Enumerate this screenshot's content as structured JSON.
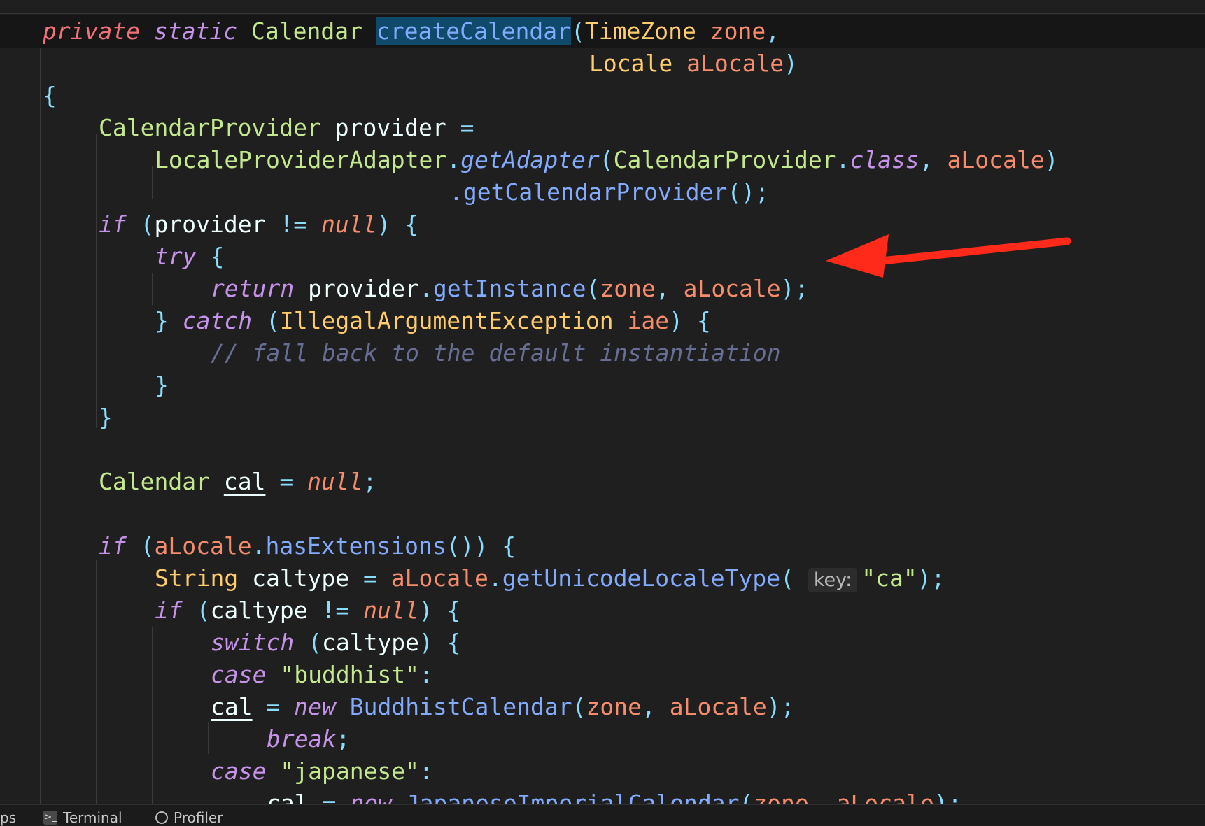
{
  "code": {
    "l1": {
      "mod1": "private",
      "mod2": "static",
      "type": "Calendar",
      "fn": "createCalendar",
      "p1": "(",
      "type2": "TimeZone",
      "param": "zone",
      "comma": ","
    },
    "l2": {
      "type": "Locale",
      "param": "aLocale",
      "close": ")"
    },
    "l3": {
      "brace": "{"
    },
    "l4": {
      "type": "CalendarProvider",
      "var": "provider",
      "op": "="
    },
    "l5": {
      "type": "LocaleProviderAdapter",
      "dot": ".",
      "fn": "getAdapter",
      "p1": "(",
      "type2": "CalendarProvider",
      "dot2": ".",
      "kw": "class",
      "comma": ",",
      "param": "aLocale",
      "close": ")"
    },
    "l6": {
      "fn": ".getCalendarProvider",
      "rest": "();"
    },
    "l7": {
      "kw": "if",
      "p1": "(",
      "var": "provider",
      "op": "!=",
      "nul": "null",
      "close": ")",
      "brace": "{"
    },
    "l8": {
      "kw": "try",
      "brace": "{"
    },
    "l9": {
      "kw": "return",
      "var": "provider",
      "dot": ".",
      "fn": "getInstance",
      "p1": "(",
      "param": "zone",
      "comma": ",",
      "param2": "aLocale",
      "close": ");"
    },
    "l10": {
      "brace": "}",
      "kw": "catch",
      "p1": "(",
      "type": "IllegalArgumentException",
      "param": "iae",
      "close": ")",
      "brace2": "{"
    },
    "l11": {
      "comment": "// fall back to the default instantiation"
    },
    "l12": {
      "brace": "}"
    },
    "l13": {
      "brace": "}"
    },
    "l15": {
      "type": "Calendar",
      "var": "cal",
      "op": "=",
      "nul": "null",
      "end": ";"
    },
    "l17": {
      "kw": "if",
      "p1": "(",
      "param": "aLocale",
      "dot": ".",
      "fn": "hasExtensions",
      "rest": "())",
      "brace": "{"
    },
    "l18": {
      "type": "String",
      "var": "caltype",
      "op": "=",
      "param": "aLocale",
      "dot": ".",
      "fn": "getUnicodeLocaleType",
      "p1": "(",
      "hint": "key:",
      "str": "\"ca\"",
      "close": ");"
    },
    "l19": {
      "kw": "if",
      "p1": "(",
      "var": "caltype",
      "op": "!=",
      "nul": "null",
      "close": ")",
      "brace": "{"
    },
    "l20": {
      "kw": "switch",
      "p1": "(",
      "var": "caltype",
      "close": ")",
      "brace": "{"
    },
    "l21": {
      "kw": "case",
      "str": "\"buddhist\"",
      "colon": ":"
    },
    "l22": {
      "var": "cal",
      "op": "=",
      "kw": "new",
      "fn": "BuddhistCalendar",
      "p1": "(",
      "param": "zone",
      "comma": ",",
      "param2": "aLocale",
      "close": ");"
    },
    "l23": {
      "kw": "break",
      "end": ";"
    },
    "l24": {
      "kw": "case",
      "str": "\"japanese\"",
      "colon": ":"
    },
    "l25": {
      "var": "cal",
      "op": "=",
      "kw": "new",
      "fn": "JapaneseImperialCalendar",
      "p1": "(",
      "param": "zone",
      "comma": ",",
      "param2": "aLocale",
      "close": ");"
    }
  },
  "bottom": {
    "left_partial": "ps",
    "terminal": "Terminal",
    "profiler": "Profiler",
    "terminal_icon": ">_"
  },
  "annotation": {
    "arrow_color": "#ff2a1a"
  }
}
